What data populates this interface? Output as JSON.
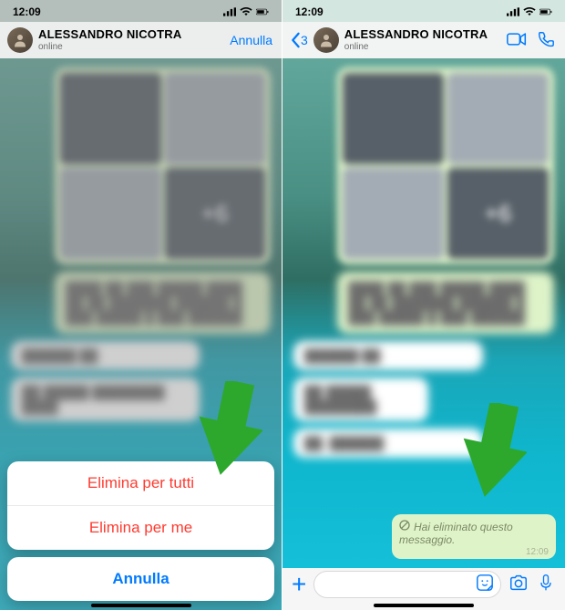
{
  "status": {
    "time": "12:09"
  },
  "contact": {
    "name": "ALESSANDRO NICOTRA",
    "status": "online"
  },
  "left": {
    "header": {
      "cancel": "Annulla"
    },
    "media": {
      "more_label": "+6"
    },
    "action_sheet": {
      "delete_for_everyone": "Elimina per tutti",
      "delete_for_me": "Elimina per me",
      "cancel": "Annulla"
    }
  },
  "right": {
    "back_count": "3",
    "media": {
      "more_label": "+6"
    },
    "deleted_message": {
      "text": "Hai eliminato questo messaggio.",
      "time": "12:09"
    }
  }
}
